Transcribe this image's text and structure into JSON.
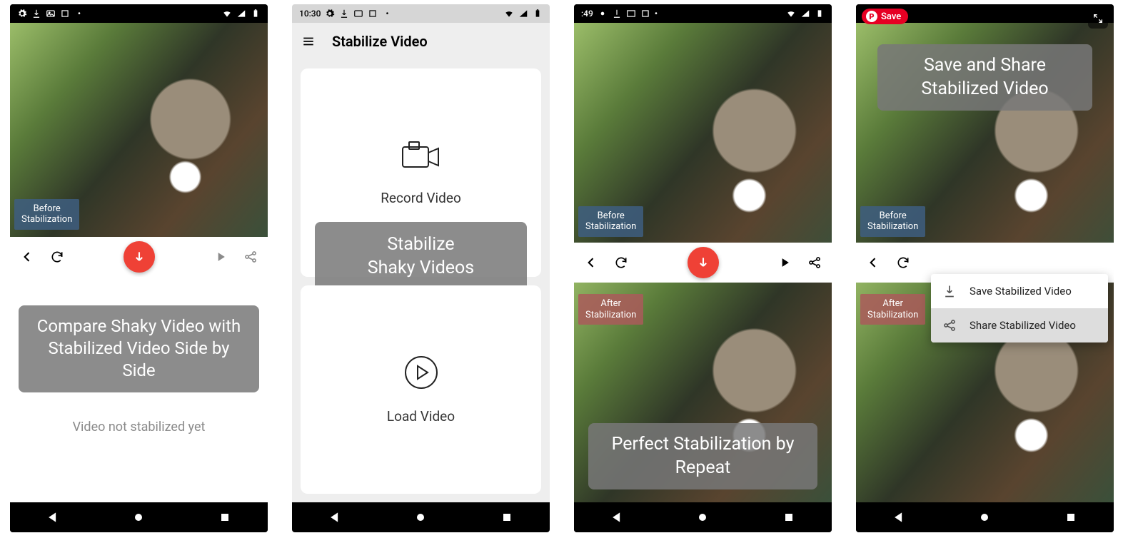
{
  "status_time": "10:30",
  "s1": {
    "badge_before": "Before\nStabilization",
    "overlay": "Compare Shaky Video with Stabilized Video Side by Side",
    "note": "Video not stabilized yet"
  },
  "s2": {
    "title": "Stabilize Video",
    "record_label": "Record Video",
    "load_label": "Load Video",
    "stabilize_overlay": "Stabilize\nShaky Videos"
  },
  "s3": {
    "badge_before": "Before\nStabilization",
    "badge_after": "After\nStabilization",
    "overlay": "Perfect Stabilization by Repeat"
  },
  "s4": {
    "badge_before": "Before\nStabilization",
    "badge_after": "After\nStabilization",
    "overlay_top": "Save and Share Stabilized Video",
    "dd_save": "Save Stabilized Video",
    "dd_share": "Share Stabilized Video",
    "pin_label": "Save"
  },
  "icons": {
    "gear": "gear-icon",
    "download": "download-icon",
    "image": "image-icon",
    "square": "square-icon",
    "triangle": "triangle-icon",
    "wifi": "wifi-icon",
    "signal": "signal-icon",
    "battery": "battery-icon"
  }
}
